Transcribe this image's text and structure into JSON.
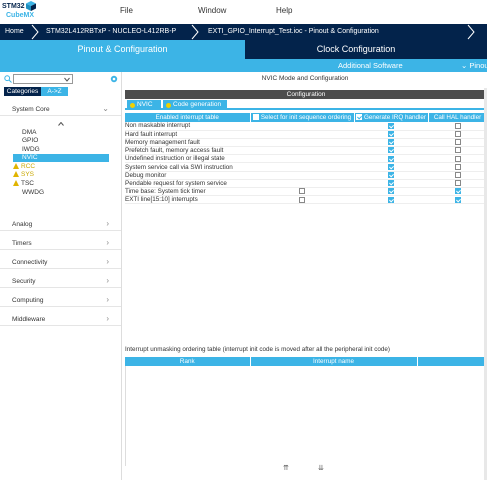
{
  "logo": {
    "line1": "STM32",
    "line2": "CubeMX"
  },
  "menu": {
    "file": "File",
    "window": "Window",
    "help": "Help"
  },
  "breadcrumbs": [
    "Home",
    "STM32L412RBTxP  -  NUCLEO-L412RB-P",
    "EXTI_GPIO_Interrupt_Test.ioc - Pinout & Configuration"
  ],
  "tabs": {
    "pinout": "Pinout & Configuration",
    "clock": "Clock Configuration"
  },
  "subbar": {
    "software": "Additional Software",
    "pinout": "Pinout"
  },
  "left": {
    "search_placeholder": "",
    "buttons": {
      "categories": "Categories",
      "az": "A->Z"
    },
    "system_core": "System Core",
    "system_core_items": [
      {
        "label": "DMA",
        "state": "normal"
      },
      {
        "label": "GPIO",
        "state": "normal"
      },
      {
        "label": "IWDG",
        "state": "normal"
      },
      {
        "label": "NVIC",
        "state": "selected"
      },
      {
        "label": "RCC",
        "state": "warning"
      },
      {
        "label": "SYS",
        "state": "warning"
      },
      {
        "label": "TSC",
        "state": "warning"
      },
      {
        "label": "WWDG",
        "state": "normal"
      }
    ],
    "categories": [
      "Analog",
      "Timers",
      "Connectivity",
      "Security",
      "Computing",
      "Middleware"
    ]
  },
  "right": {
    "title": "NVIC Mode and Configuration",
    "config_label": "Configuration",
    "subtabs": {
      "nvic": "NVIC",
      "codegen": "Code generation"
    },
    "columns": [
      "Enabled interrupt table",
      "Select for init sequence ordering",
      "Generate IRQ handler",
      "Call HAL handler"
    ],
    "rows": [
      {
        "name": "Non maskable interrupt",
        "select": null,
        "irq": true,
        "hal": false
      },
      {
        "name": "Hard fault interrupt",
        "select": null,
        "irq": true,
        "hal": false
      },
      {
        "name": "Memory management fault",
        "select": null,
        "irq": true,
        "hal": false
      },
      {
        "name": "Prefetch fault, memory access fault",
        "select": null,
        "irq": true,
        "hal": false
      },
      {
        "name": "Undefined instruction or illegal state",
        "select": null,
        "irq": true,
        "hal": false
      },
      {
        "name": "System service call via SWI instruction",
        "select": null,
        "irq": true,
        "hal": false
      },
      {
        "name": "Debug monitor",
        "select": null,
        "irq": true,
        "hal": false
      },
      {
        "name": "Pendable request for system service",
        "select": null,
        "irq": true,
        "hal": false
      },
      {
        "name": "Time base: System tick timer",
        "select": false,
        "irq": true,
        "hal": true
      },
      {
        "name": "EXTI line[15:10] interrupts",
        "select": false,
        "irq": true,
        "hal": true
      }
    ],
    "order_label": "Interrupt unmasking ordering table (interrupt init code is moved after all the peripheral init code)",
    "order_columns": [
      "Rank",
      "Interrupt name"
    ],
    "move_up": "⇈",
    "move_down": "⇊"
  }
}
